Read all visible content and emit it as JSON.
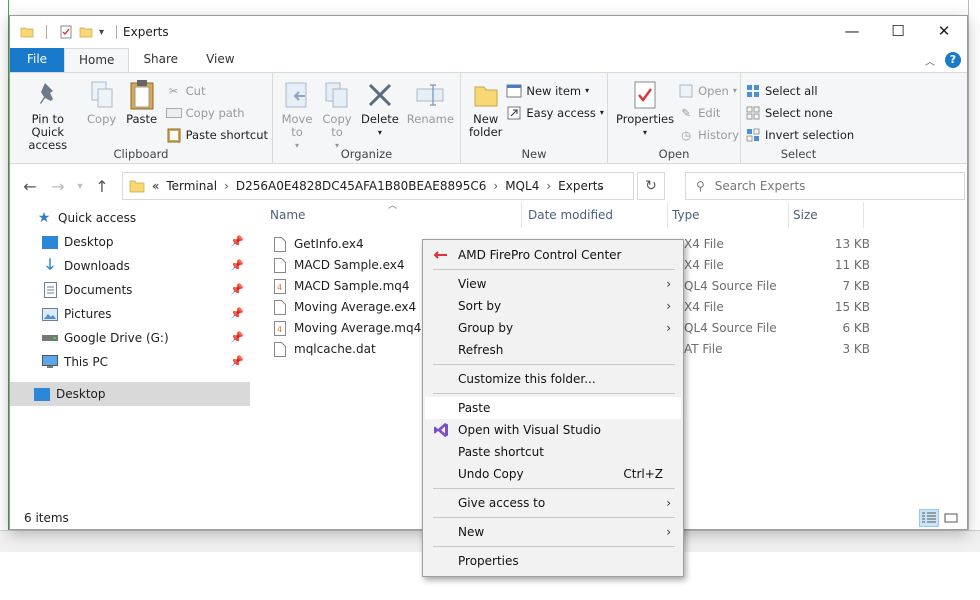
{
  "window": {
    "title": "Experts",
    "controls": {
      "minimize": "—",
      "maximize": "☐",
      "close": "✕"
    }
  },
  "ribbon_tabs": [
    "File",
    "Home",
    "Share",
    "View"
  ],
  "ribbon": {
    "clipboard": {
      "label": "Clipboard",
      "pin": "Pin to Quick access",
      "copy": "Copy",
      "paste": "Paste",
      "cut": "Cut",
      "copy_path": "Copy path",
      "paste_shortcut": "Paste shortcut"
    },
    "organize": {
      "label": "Organize",
      "move_to": "Move to",
      "copy_to": "Copy to",
      "delete": "Delete",
      "rename": "Rename"
    },
    "new": {
      "label": "New",
      "new_folder": "New folder",
      "new_item": "New item",
      "easy_access": "Easy access"
    },
    "open": {
      "label": "Open",
      "properties": "Properties",
      "open": "Open",
      "edit": "Edit",
      "history": "History"
    },
    "select": {
      "label": "Select",
      "select_all": "Select all",
      "select_none": "Select none",
      "invert": "Invert selection"
    }
  },
  "address": {
    "overflow": "«",
    "crumbs": [
      "Terminal",
      "D256A0E4828DC45AFA1B80BEAE8895C6",
      "MQL4",
      "Experts"
    ],
    "search_placeholder": "Search Experts"
  },
  "nav": {
    "quick_access": "Quick access",
    "items": [
      "Desktop",
      "Downloads",
      "Documents",
      "Pictures",
      "Google Drive (G:)",
      "This PC"
    ],
    "desktop_root": "Desktop"
  },
  "columns": {
    "name": "Name",
    "date": "Date modified",
    "type": "Type",
    "size": "Size"
  },
  "files": [
    {
      "name": "GetInfo.ex4",
      "type": "X4 File",
      "size": "13 KB",
      "kind": "blank"
    },
    {
      "name": "MACD Sample.ex4",
      "type": "X4 File",
      "size": "11 KB",
      "kind": "blank"
    },
    {
      "name": "MACD Sample.mq4",
      "type": "QL4 Source File",
      "size": "7 KB",
      "kind": "mq4"
    },
    {
      "name": "Moving Average.ex4",
      "type": "X4 File",
      "size": "15 KB",
      "kind": "blank"
    },
    {
      "name": "Moving Average.mq4",
      "type": "QL4 Source File",
      "size": "6 KB",
      "kind": "mq4"
    },
    {
      "name": "mqlcache.dat",
      "type": "AT File",
      "size": "3 KB",
      "kind": "blank"
    }
  ],
  "status": {
    "count": "6 items"
  },
  "context_menu": {
    "amd": "AMD FirePro Control Center",
    "view": "View",
    "sort_by": "Sort by",
    "group_by": "Group by",
    "refresh": "Refresh",
    "customize": "Customize this folder...",
    "paste": "Paste",
    "open_vs": "Open with Visual Studio",
    "paste_shortcut": "Paste shortcut",
    "undo_copy": "Undo Copy",
    "undo_shortcut": "Ctrl+Z",
    "give_access": "Give access to",
    "new": "New",
    "properties": "Properties"
  },
  "colors": {
    "accent": "#1979ca",
    "folder": "#f8d775",
    "mq4": "#e8772e"
  }
}
